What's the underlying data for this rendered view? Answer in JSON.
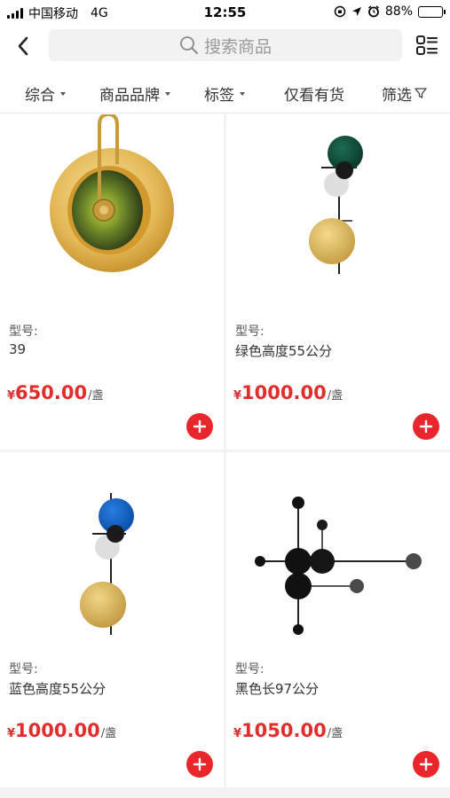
{
  "status_bar": {
    "carrier": "中国移动",
    "network": "4G",
    "time": "12:55",
    "battery_percent": 88,
    "battery_text": "88%"
  },
  "nav": {
    "back_icon": "chevron-left-icon",
    "search_placeholder": "搜索商品",
    "layout_icon": "grid-list-toggle-icon"
  },
  "filters": [
    {
      "label": "综合"
    },
    {
      "label": "商品品牌"
    },
    {
      "label": "标签"
    },
    {
      "label": "仅看有货"
    },
    {
      "label": "筛选"
    }
  ],
  "products": [
    {
      "model_label": "型号:",
      "model": "39",
      "currency": "¥",
      "price": "650.00",
      "unit": "/盏",
      "image": "gold-disc-wall-lamp"
    },
    {
      "model_label": "型号:",
      "model": "绿色高度55公分",
      "currency": "¥",
      "price": "1000.00",
      "unit": "/盏",
      "image": "green-ball-wall-lamp"
    },
    {
      "model_label": "型号:",
      "model": "蓝色高度55公分",
      "currency": "¥",
      "price": "1000.00",
      "unit": "/盏",
      "image": "blue-ball-wall-lamp"
    },
    {
      "model_label": "型号:",
      "model": "黑色长97公分",
      "currency": "¥",
      "price": "1050.00",
      "unit": "/盏",
      "image": "black-branch-wall-lamp"
    }
  ],
  "colors": {
    "price_red": "#e22d2d",
    "add_button_red": "#e8262c",
    "search_bg": "#f2f2f2"
  }
}
